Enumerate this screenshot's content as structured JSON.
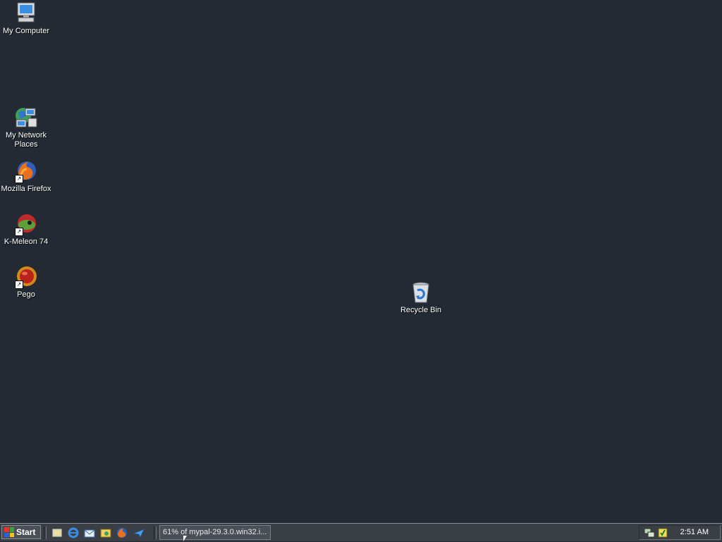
{
  "desktop": {
    "background": "#232a33",
    "icons": [
      {
        "label": "My Computer",
        "icon": "computer-icon"
      },
      {
        "label": "My Network Places",
        "icon": "network-places-icon"
      },
      {
        "label": "Mozilla Firefox",
        "icon": "firefox-icon",
        "shortcut": true
      },
      {
        "label": "K-Meleon 74",
        "icon": "k-meleon-icon",
        "shortcut": true
      },
      {
        "label": "Pego",
        "icon": "pego-icon",
        "shortcut": true
      },
      {
        "label": "Recycle Bin",
        "icon": "recycle-bin-icon"
      }
    ]
  },
  "taskbar": {
    "start_label": "Start",
    "quick_launch": [
      "show-desktop-icon",
      "internet-explorer-icon",
      "outlook-express-icon",
      "explorer-icon",
      "firefox-icon",
      "send-icon"
    ],
    "tasks": [
      {
        "label": "61% of mypal-29.3.0.win32.i..."
      }
    ],
    "tray_icons": [
      "network-tray-icon",
      "security-tray-icon"
    ],
    "clock": "2:51 AM"
  }
}
